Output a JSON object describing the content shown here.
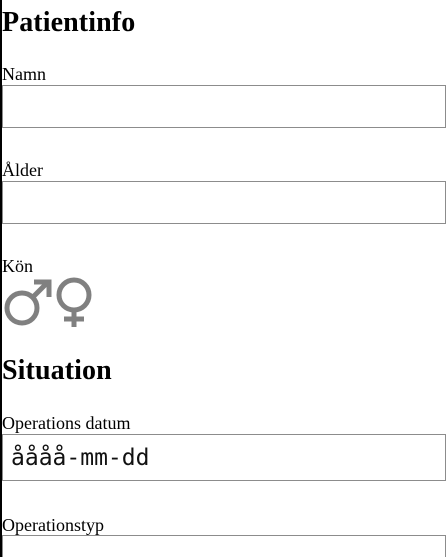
{
  "patient_section": {
    "heading": "Patientinfo",
    "name": {
      "label": "Namn",
      "value": "",
      "placeholder": ""
    },
    "age": {
      "label": "Ålder",
      "value": "",
      "placeholder": ""
    },
    "gender": {
      "label": "Kön",
      "options": [
        {
          "icon": "male-icon"
        },
        {
          "icon": "female-icon"
        }
      ],
      "icon_color": "#808080"
    }
  },
  "situation_section": {
    "heading": "Situation",
    "operation_date": {
      "label": "Operations datum",
      "placeholder": "åååå-mm-dd"
    },
    "operation_type": {
      "label": "Operationstyp",
      "value": ""
    }
  }
}
